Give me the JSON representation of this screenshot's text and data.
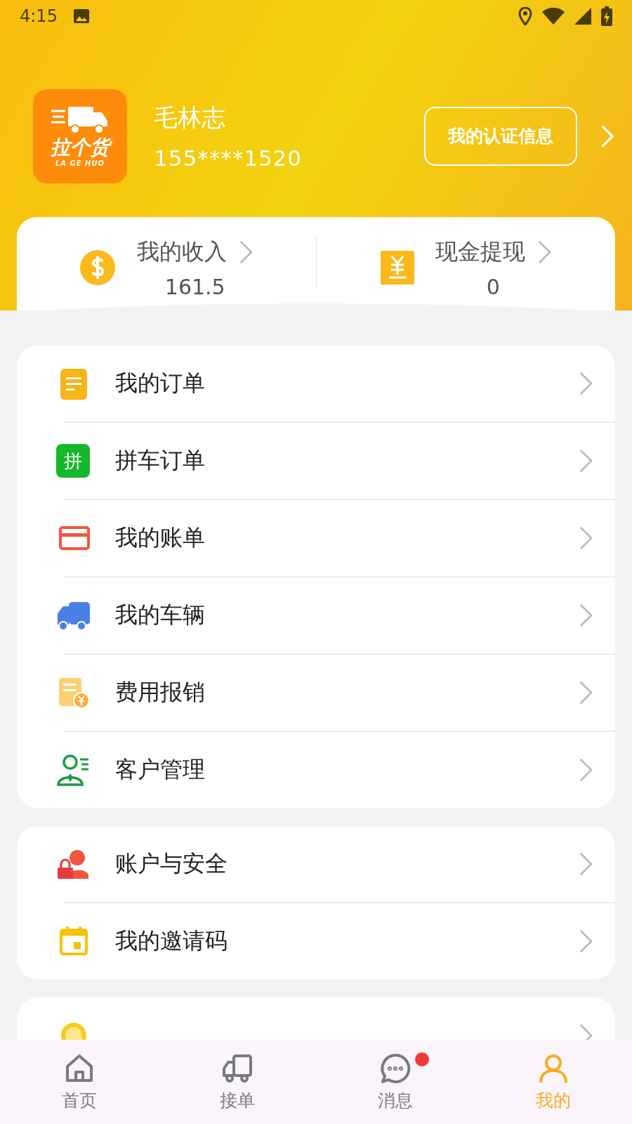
{
  "status_bar": {
    "time": "4:15"
  },
  "profile": {
    "logo_text": "拉个货",
    "logo_subtext": "LA GE HUO",
    "name": "毛林志",
    "phone": "155****1520",
    "cert_button": "我的认证信息"
  },
  "summary": [
    {
      "kind": "coin",
      "label": "我的收入",
      "value": "161.5"
    },
    {
      "kind": "yuan",
      "label": "现金提现",
      "value": "0"
    }
  ],
  "menu_groups": [
    {
      "items": [
        {
          "kind": "orders",
          "label": "我的订单"
        },
        {
          "kind": "carpool",
          "label": "拼车订单",
          "icon_text": "拼"
        },
        {
          "kind": "bill",
          "label": "我的账单"
        },
        {
          "kind": "vehicle",
          "label": "我的车辆"
        },
        {
          "kind": "expense",
          "label": "费用报销"
        },
        {
          "kind": "customer",
          "label": "客户管理"
        }
      ]
    },
    {
      "items": [
        {
          "kind": "security",
          "label": "账户与安全"
        },
        {
          "kind": "invite",
          "label": "我的邀请码"
        }
      ]
    },
    {
      "items": [
        {
          "kind": "feedback"
        }
      ]
    }
  ],
  "tabs": [
    {
      "kind": "home",
      "label": "首页",
      "selected": false,
      "badge": false
    },
    {
      "kind": "truck",
      "label": "接单",
      "selected": false,
      "badge": false
    },
    {
      "kind": "message",
      "label": "消息",
      "selected": false,
      "badge": true
    },
    {
      "kind": "me",
      "label": "我的",
      "selected": true,
      "badge": false
    }
  ]
}
